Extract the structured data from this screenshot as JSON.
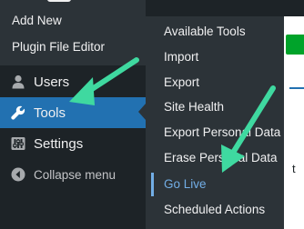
{
  "sidebar": {
    "submenu_items": [
      {
        "label": "Add New"
      },
      {
        "label": "Plugin File Editor"
      }
    ],
    "items": [
      {
        "label": "Users",
        "icon": "users-icon"
      },
      {
        "label": "Tools",
        "icon": "wrench-icon"
      },
      {
        "label": "Settings",
        "icon": "sliders-icon"
      }
    ],
    "collapse_label": "Collapse menu"
  },
  "tools_flyout": {
    "items": [
      {
        "label": "Available Tools"
      },
      {
        "label": "Import"
      },
      {
        "label": "Export"
      },
      {
        "label": "Site Health"
      },
      {
        "label": "Export Personal Data"
      },
      {
        "label": "Erase Personal Data"
      },
      {
        "label": "Go Live",
        "highlighted": true
      },
      {
        "label": "Scheduled Actions"
      }
    ]
  },
  "page": {
    "partial_text": "t"
  },
  "colors": {
    "sidebar_bg": "#1d2327",
    "submenu_bg": "#2c3338",
    "text": "#f0f0f1",
    "active_link": "#72aee6",
    "annotation_arrow": "#3fd9a0",
    "button_green": "#00a32a"
  }
}
